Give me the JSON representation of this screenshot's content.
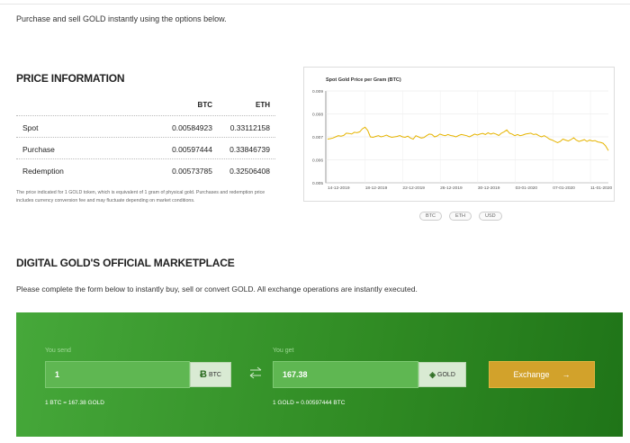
{
  "intro": "Purchase and sell GOLD instantly using the options below.",
  "price_section": {
    "title": "PRICE INFORMATION",
    "col_btc": "BTC",
    "col_eth": "ETH",
    "rows": [
      {
        "label": "Spot",
        "btc": "0.00584923",
        "eth": "0.33112158"
      },
      {
        "label": "Purchase",
        "btc": "0.00597444",
        "eth": "0.33846739"
      },
      {
        "label": "Redemption",
        "btc": "0.00573785",
        "eth": "0.32506408"
      }
    ],
    "note": "The price indicated for 1 GOLD token, which is equivalent of 1 gram of physical gold. Purchases and redemption price includes currency conversion fee and may fluctuate depending on market conditions."
  },
  "chart_data": {
    "type": "line",
    "title": "Spot Gold Price per Gram (BTC)",
    "xlabel": "",
    "ylabel": "",
    "ylim": [
      0.005,
      0.009
    ],
    "yticks": [
      "0.009",
      "0.008",
      "0.007",
      "0.006",
      "0.005"
    ],
    "xtick_labels": [
      "14-12-2019",
      "18-12-2019",
      "22-12-2019",
      "26-12-2019",
      "30-12-2019",
      "03-01-2020",
      "07-01-2020",
      "11-01-2020"
    ],
    "grid": true,
    "series": [
      {
        "values": [
          0.0069,
          0.00692,
          0.00695,
          0.007,
          0.00705,
          0.00703,
          0.00706,
          0.00716,
          0.00715,
          0.00712,
          0.0072,
          0.00718,
          0.00722,
          0.00735,
          0.00742,
          0.00728,
          0.007,
          0.00698,
          0.00702,
          0.00705,
          0.007,
          0.00703,
          0.00708,
          0.00702,
          0.00698,
          0.007,
          0.00702,
          0.00706,
          0.007,
          0.00698,
          0.00703,
          0.00695,
          0.0069,
          0.00705,
          0.007,
          0.00695,
          0.00697,
          0.00705,
          0.00712,
          0.0071,
          0.007,
          0.00704,
          0.00712,
          0.00708,
          0.00705,
          0.0071,
          0.00706,
          0.00704,
          0.007,
          0.00706,
          0.0071,
          0.00708,
          0.00705,
          0.007,
          0.00706,
          0.00712,
          0.00708,
          0.00712,
          0.00715,
          0.0071,
          0.00718,
          0.00712,
          0.00716,
          0.00712,
          0.00706,
          0.00716,
          0.00722,
          0.0073,
          0.00716,
          0.00712,
          0.00705,
          0.0071,
          0.00705,
          0.00708,
          0.00712,
          0.00714,
          0.00716,
          0.0071,
          0.00712,
          0.00705,
          0.007,
          0.00705,
          0.00698,
          0.0069,
          0.00686,
          0.0068,
          0.00675,
          0.0068,
          0.0069,
          0.00686,
          0.00682,
          0.00688,
          0.00696,
          0.00686,
          0.0068,
          0.00684,
          0.00688,
          0.0068,
          0.00686,
          0.00682,
          0.00684,
          0.00678,
          0.00676,
          0.00672,
          0.0066,
          0.0064
        ]
      }
    ],
    "line_color": "#e6b400",
    "currency_buttons": [
      "BTC",
      "ETH",
      "USD"
    ]
  },
  "marketplace": {
    "title": "DIGITAL GOLD'S OFFICIAL MARKETPLACE",
    "description": "Please complete the form below to instantly buy, sell or convert GOLD. All exchange operations are instantly executed."
  },
  "exchange": {
    "send_label": "You send",
    "send_value": "1",
    "send_currency": "BTC",
    "send_symbol": "Ƀ",
    "get_label": "You get",
    "get_value": "167.38",
    "get_currency": "GOLD",
    "get_symbol": "◈",
    "send_rate": "1 BTC = 167.38 GOLD",
    "get_rate": "1 GOLD = 0.00597444 BTC",
    "button_label": "Exchange",
    "button_arrow": "→",
    "swap_icon": "←→",
    "accent_color": "#d2a22b"
  }
}
